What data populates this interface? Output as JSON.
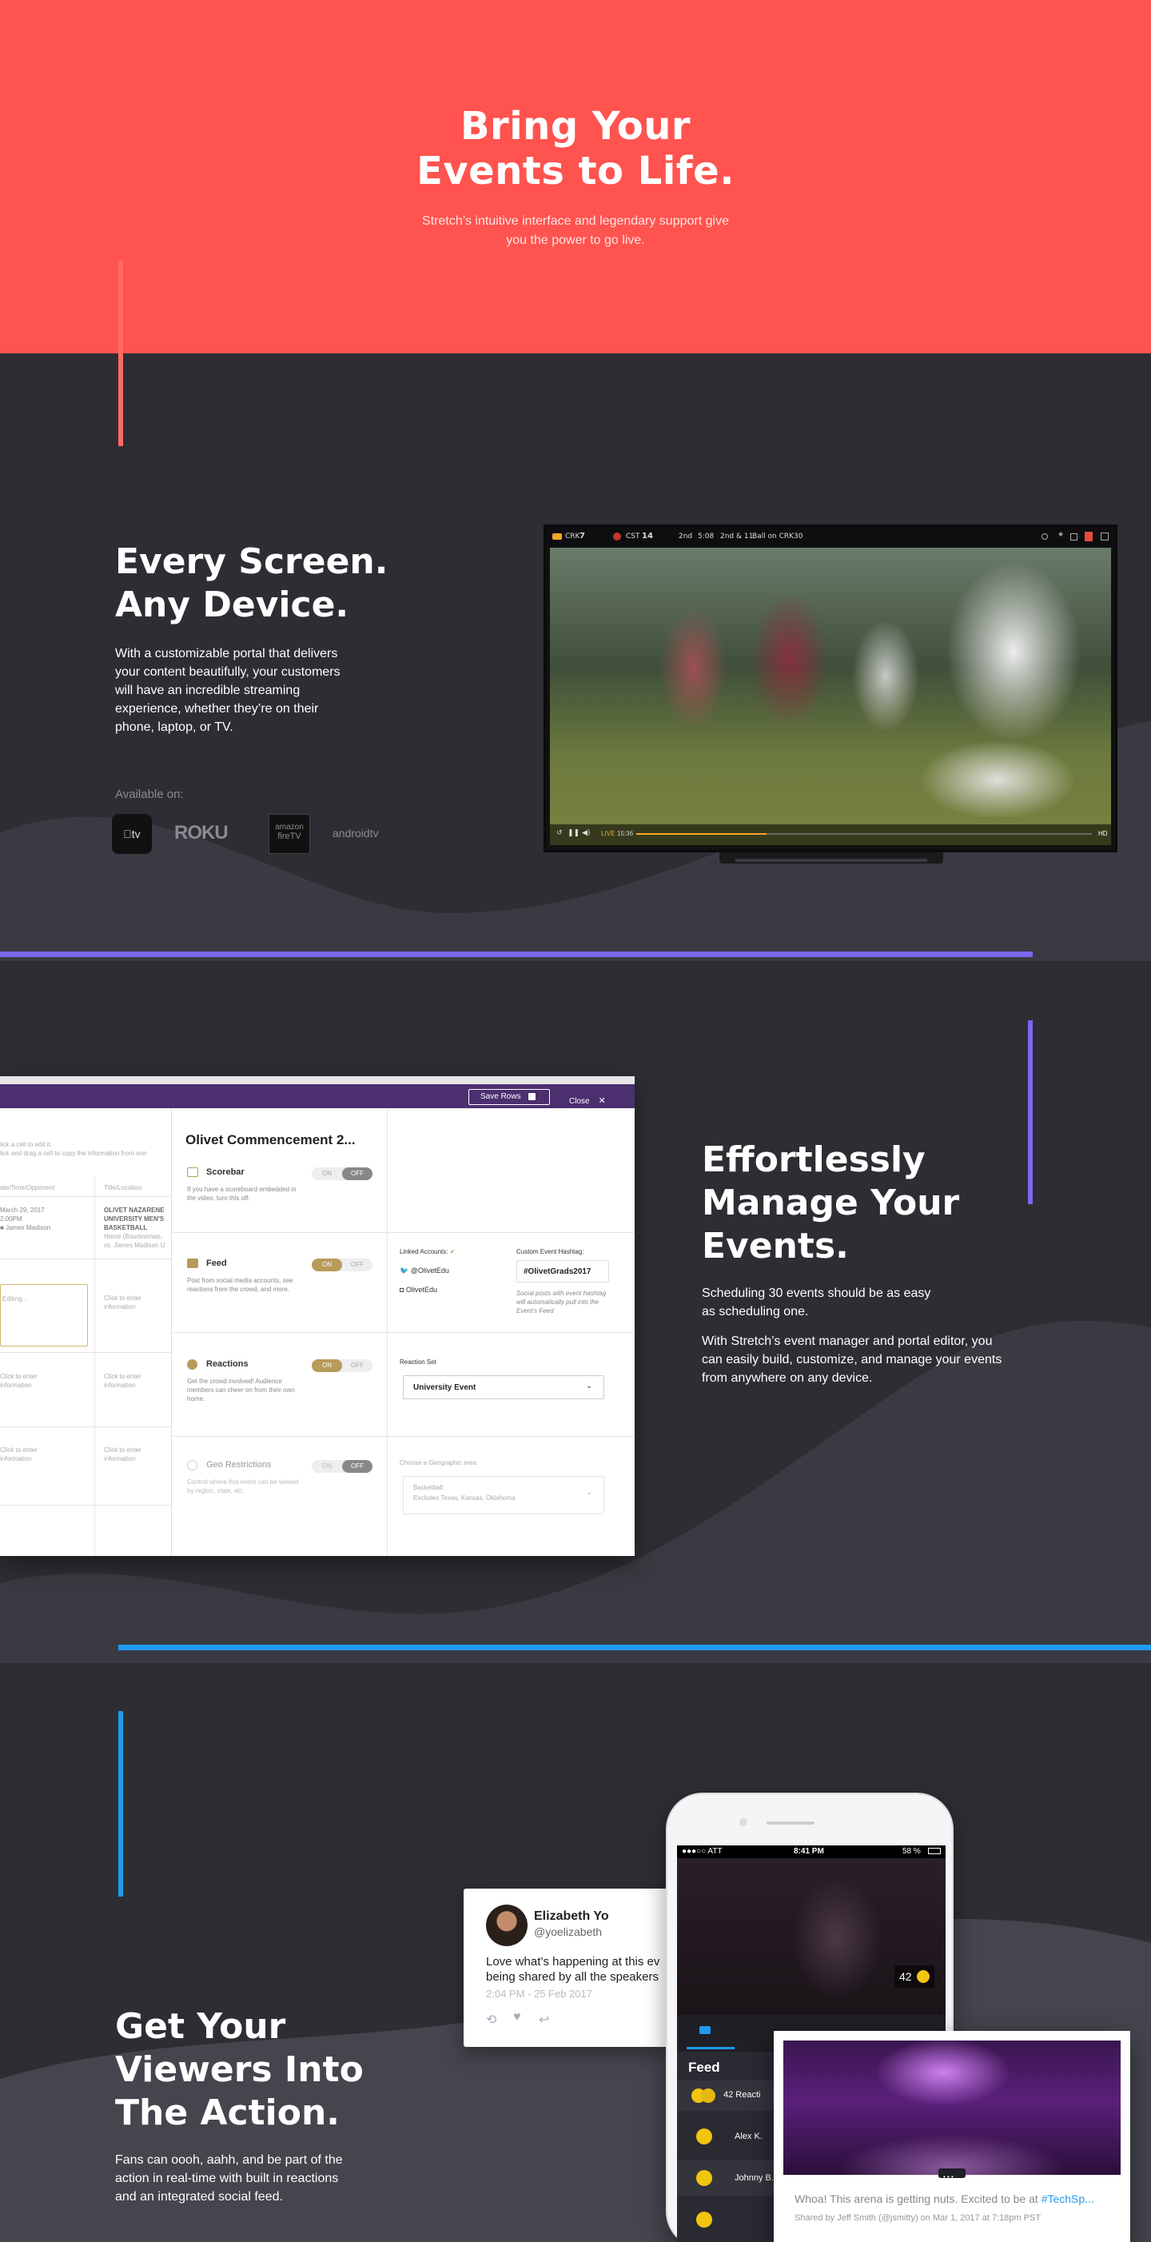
{
  "hero": {
    "title": "Bring Your\nEvents to Life.",
    "subtitle": "Stretch’s intuitive interface and legendary support give you the power to go live."
  },
  "devices": {
    "title": "Every Screen.\nAny Device.",
    "body": "With a customizable portal that delivers your content beautifully, your customers will have an incredible streaming experience, whether they’re on their phone, laptop, or TV.",
    "available_label": "Available on:",
    "logos": {
      "appletv": "tv",
      "roku": "ROKU",
      "amazon_top": "amazon",
      "amazon_bottom": "fireTV",
      "androidtv": "androidtv"
    },
    "tv_scoreboard": {
      "team1": "CRK",
      "score1": "7",
      "team2": "CST",
      "score2": "14",
      "quarter": "2nd",
      "clock": "5:08",
      "down": "2nd & 11",
      "ball_on": "Ball on CRK30",
      "live": "LIVE",
      "time": "15:36",
      "hd": "HD"
    }
  },
  "manage": {
    "title": "Effortlessly\nManage Your\nEvents.",
    "body1": "Scheduling 30 events should be as easy as scheduling one.",
    "body2": "With Stretch’s event manager and portal editor, you can easily build, customize, and manage your events from anywhere on any device."
  },
  "event_manager": {
    "save_rows": "Save Rows",
    "close": "Close",
    "event_title": "Olivet Commencement 2...",
    "hint1": "lick a cell to edit it.",
    "hint2": "lick and drag a cell to copy the information from one",
    "col_date": "ate/Time/Opponent",
    "col_title": "Title/Location",
    "row1_date": "March 29, 2017",
    "row1_time": "2:00PM",
    "row1_opp": "James Madison",
    "row1_title": "OLIVET NAZARENE UNIVERSITY MEN'S BASKETBALL",
    "row1_loc": "Home (Bourbonnais, vs. James Madison U",
    "editing": "Editing...",
    "click_enter": "Click to enter information",
    "scorebar": {
      "label": "Scorebar",
      "desc": "If you have a scoreboard embedded in the video, turn this off.",
      "on": "ON",
      "off": "OFF"
    },
    "feed": {
      "label": "Feed",
      "desc": "Post from social media accounts, see reactions from the crowd, and more.",
      "on": "ON",
      "off": "OFF",
      "linked_label": "Linked Accounts:",
      "twitter": "@OlivetEdu",
      "instagram": "OlivetEdu",
      "hashtag_label": "Custom Event Hashtag:",
      "hashtag": "#OlivetGrads2017",
      "hashtag_note": "Social posts with event hashtag will automatically pull into the Event’s Feed"
    },
    "reactions": {
      "label": "Reactions",
      "desc": "Get the crowd involved! Audience members can cheer on from their own home.",
      "on": "ON",
      "off": "OFF",
      "set_label": "Reaction Set",
      "set_value": "University Event"
    },
    "geo": {
      "label": "Geo Restrictions",
      "desc": "Control where this event can be viewed by region, state, etc.",
      "on": "ON",
      "off": "OFF",
      "area_label": "Choose a Geographic area",
      "area_value": "Basketball",
      "area_sub": "Excludes Texas, Kansas, Oklahoma"
    }
  },
  "social": {
    "title": "Get Your\nViewers Into\nThe Action.",
    "body": "Fans can oooh, aahh, and be part of the action in real-time with built in reactions and an integrated social feed."
  },
  "tweet": {
    "name": "Elizabeth Yo",
    "handle": "@yoelizabeth",
    "text": "Love what’s happening at this ev being shared by all the speakers",
    "time": "2:04 PM - 25 Feb 2017"
  },
  "phone": {
    "carrier": "●●●○○ ATT",
    "time": "8:41 PM",
    "battery": "58 %",
    "reaction_count": "42",
    "feed_title": "Feed",
    "reactions_row": "42 Reacti",
    "user1": "Alex K.",
    "user2": "Johnny B."
  },
  "card": {
    "text_prefix": "Whoa! This arena is getting nuts. Excited to be at ",
    "hashtag": "#TechSp...",
    "shared_by": "Shared by Jeff Smith (@jsmitty) on Mar 1, 2017 at 7:18pm PST"
  },
  "colors": {
    "hero_red": "#ff534f",
    "dark_bg": "#2d2d33",
    "purple": "#7b68ee",
    "blue": "#1e9bf0",
    "gold": "#b89a5a"
  }
}
